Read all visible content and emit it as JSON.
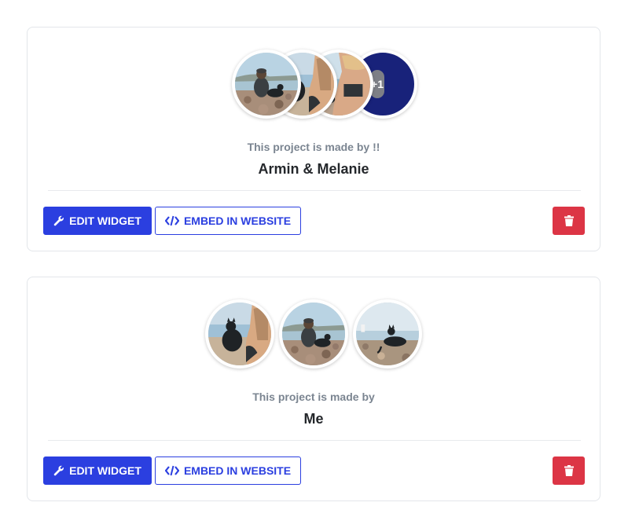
{
  "colors": {
    "primary": "#2b3fe0",
    "danger": "#dc3545",
    "plus_bg": "#18227a"
  },
  "cards": [
    {
      "made_by_label": "This project is made by !!",
      "names": "Armin & Melanie",
      "extra_count": "+1",
      "edit_label": "EDIT WIDGET",
      "embed_label": "EMBED IN WEBSITE",
      "avatars": [
        "photo-woman-with-dog-on-rocks",
        "photo-dog-on-beach",
        "photo-woman-by-sea",
        "plus-one-badge"
      ]
    },
    {
      "made_by_label": "This project is made by",
      "names": "Me",
      "edit_label": "EDIT WIDGET",
      "embed_label": "EMBED IN WEBSITE",
      "avatars": [
        "photo-dog-and-woman-sitting",
        "photo-woman-with-dog-on-rocks",
        "photo-dog-on-shore"
      ]
    }
  ],
  "icons": {
    "edit": "wrench-icon",
    "embed": "code-icon",
    "delete": "trash-icon"
  }
}
